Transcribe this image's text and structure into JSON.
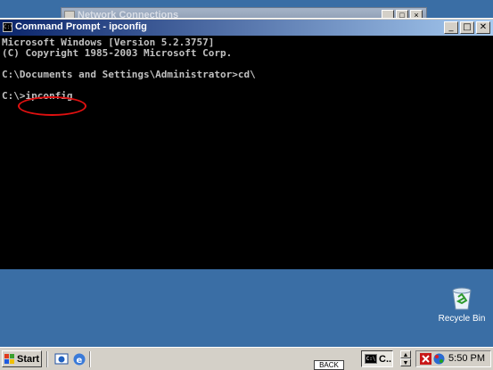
{
  "background_window": {
    "title": "Network Connections"
  },
  "cmd_window": {
    "title": "Command Prompt - ipconfig",
    "lines": [
      "Microsoft Windows [Version 5.2.3757]",
      "(C) Copyright 1985-2003 Microsoft Corp.",
      "",
      "C:\\Documents and Settings\\Administrator>cd\\",
      "",
      "C:\\>ipconfig"
    ],
    "buttons": {
      "minimize": "_",
      "maximize": "□",
      "close": "✕"
    }
  },
  "desktop": {
    "recycle_bin_label": "Recycle Bin"
  },
  "taskbar": {
    "start_label": "Start",
    "task_label": "C..",
    "clock": "5:50 PM"
  },
  "overlay": {
    "back_label": "BACK"
  },
  "colors": {
    "desktop": "#3a6ea5",
    "titlebar_start": "#0a246a",
    "titlebar_end": "#a6caf0",
    "console_bg": "#000000",
    "console_text": "#c0c0c0",
    "annotation": "#e01010"
  }
}
